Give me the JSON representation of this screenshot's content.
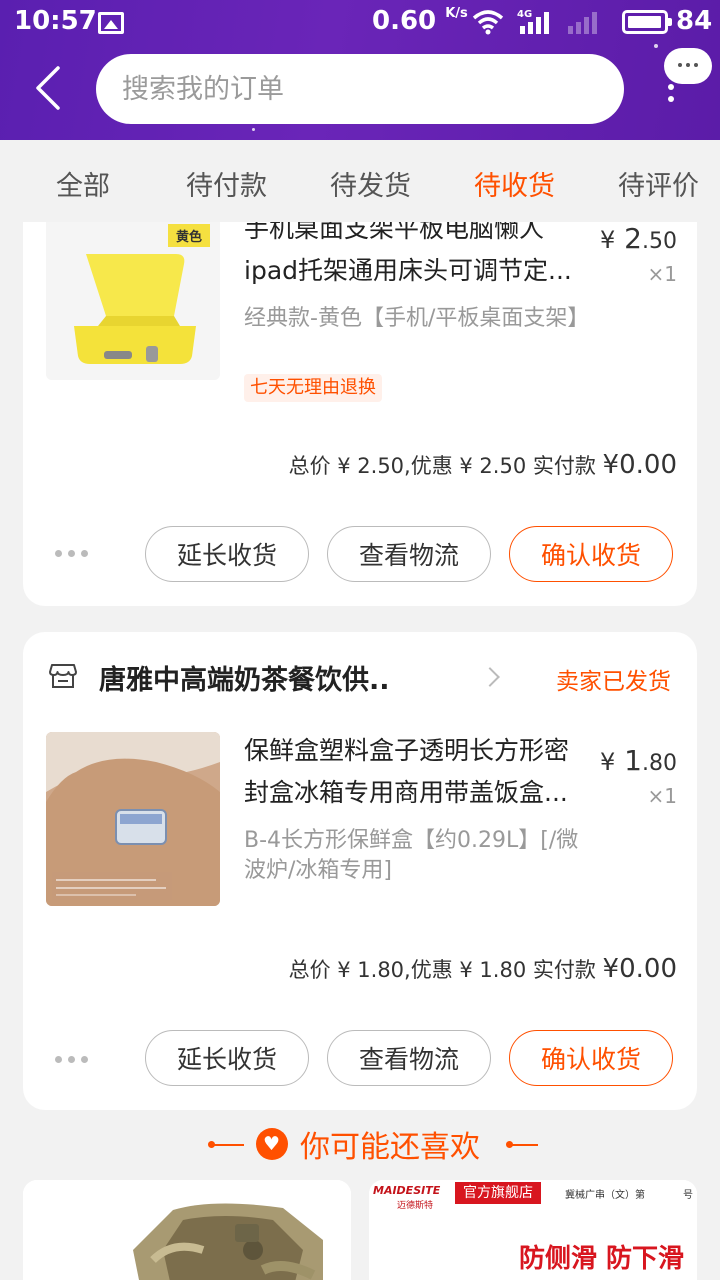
{
  "status_bar": {
    "time": "10:57",
    "speed_value": "0.60",
    "speed_unit": "K/s",
    "network": "4G",
    "battery": "84"
  },
  "header": {
    "search_placeholder": "搜索我的订单"
  },
  "tabs": [
    {
      "label": "全部",
      "active": false
    },
    {
      "label": "待付款",
      "active": false
    },
    {
      "label": "待发货",
      "active": false
    },
    {
      "label": "待收货",
      "active": true
    },
    {
      "label": "待评价",
      "active": false
    }
  ],
  "orders": [
    {
      "image_tag": "黄色",
      "title_line1": "手机桌面支架平板电脑懒人",
      "title_line2": "ipad托架通用床头可调节定...",
      "price_symbol": "¥",
      "price_int": "2",
      "price_dec": ".50",
      "qty": "×1",
      "sku": "经典款-黄色【手机/平板桌面支架】",
      "tag": "七天无理由退换",
      "total": "总价 ¥ 2.50,优惠 ¥ 2.50  实付款 ",
      "paid_symbol": "¥",
      "paid_int": "0",
      "paid_dec": ".00",
      "btn_extend": "延长收货",
      "btn_logistics": "查看物流",
      "btn_confirm": "确认收货"
    },
    {
      "shop_name": "唐雅中高端奶茶餐饮供..",
      "shop_status": "卖家已发货",
      "title_line1": "保鲜盒塑料盒子透明长方形密",
      "title_line2": "封盒冰箱专用商用带盖饭盒...",
      "price_symbol": "¥",
      "price_int": "1",
      "price_dec": ".80",
      "qty": "×1",
      "sku": "B-4长方形保鲜盒【约0.29L】[/微波炉/冰箱专用]",
      "total": "总价 ¥ 1.80,优惠 ¥ 1.80  实付款 ",
      "paid_symbol": "¥",
      "paid_int": "0",
      "paid_dec": ".00",
      "btn_extend": "延长收货",
      "btn_logistics": "查看物流",
      "btn_confirm": "确认收货"
    }
  ],
  "recommend": {
    "title": "你可能还喜欢",
    "item2_brand": "MAIDESITE",
    "item2_brand_cn": "迈德斯特",
    "item2_badge": "官方旗舰店",
    "item2_reg": "冀械广串（文）第",
    "item2_reg_suffix": "号",
    "item2_slogan": "防侧滑 防下滑"
  },
  "colors": {
    "accent": "#ff5000",
    "header": "#5a1fb0"
  }
}
